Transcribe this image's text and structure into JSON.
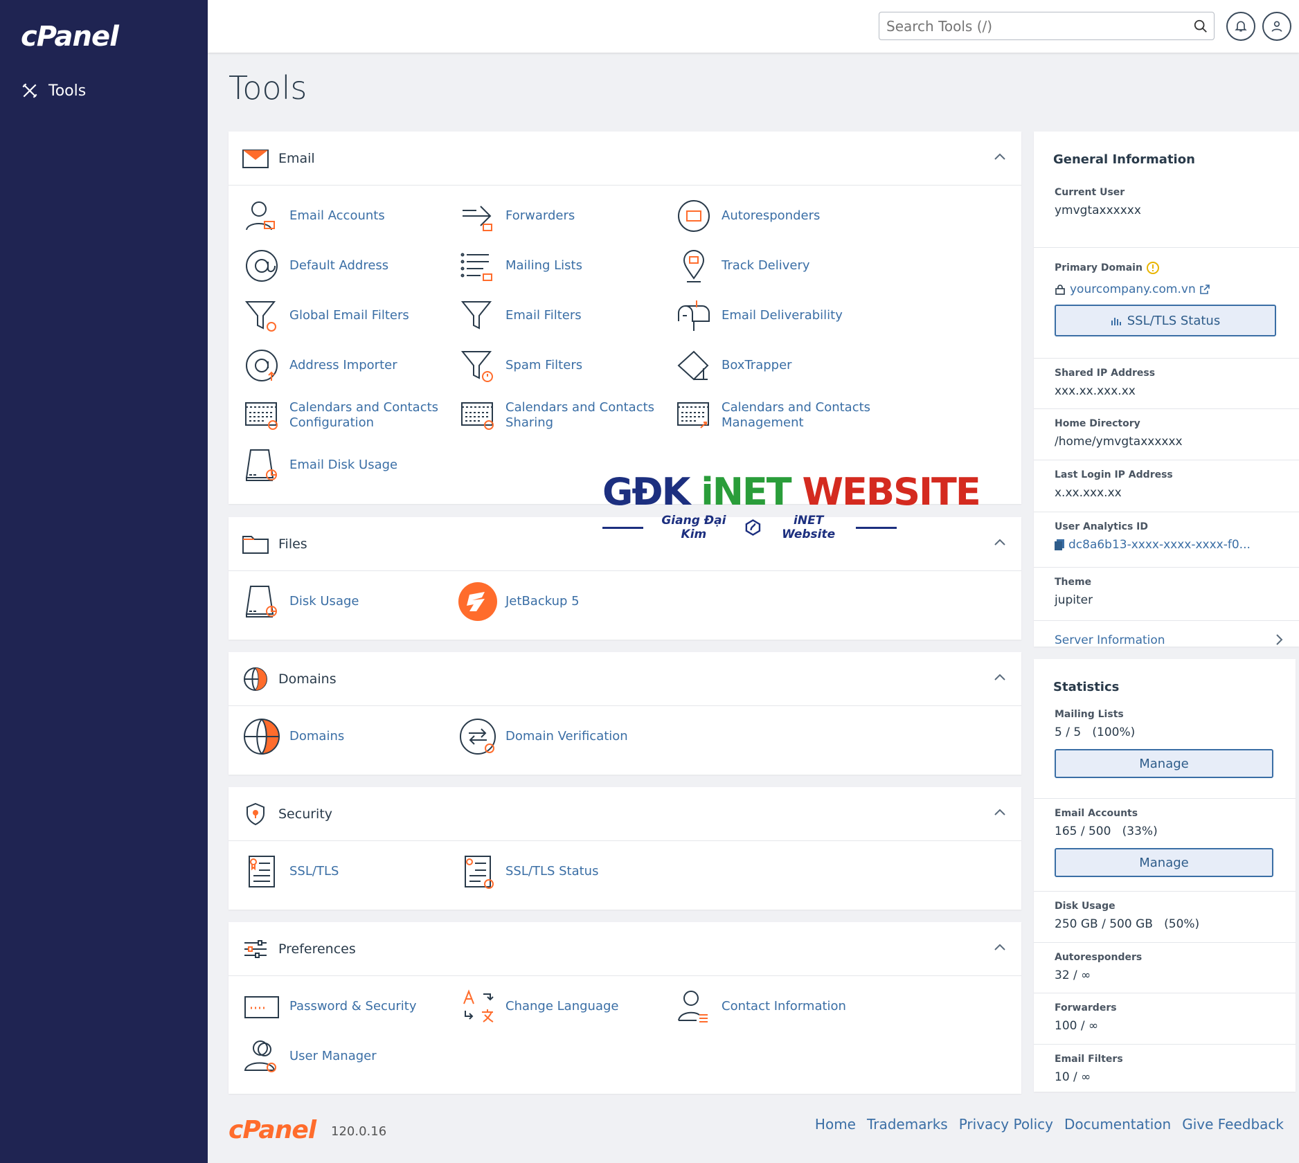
{
  "sidebar": {
    "brand": "cPanel",
    "nav_item": "Tools"
  },
  "topbar": {
    "search_placeholder": "Search Tools (/)"
  },
  "page_title": "Tools",
  "sections": {
    "email": {
      "title": "Email",
      "tools": [
        "Email Accounts",
        "Forwarders",
        "Autoresponders",
        "Default Address",
        "Mailing Lists",
        "Track Delivery",
        "Global Email Filters",
        "Email Filters",
        "Email Deliverability",
        "Address Importer",
        "Spam Filters",
        "BoxTrapper",
        "Calendars and Contacts Configuration",
        "Calendars and Contacts Sharing",
        "Calendars and Contacts Management",
        "Email Disk Usage"
      ]
    },
    "files": {
      "title": "Files",
      "tools": [
        "Disk Usage",
        "JetBackup 5"
      ]
    },
    "domains": {
      "title": "Domains",
      "tools": [
        "Domains",
        "Domain Verification"
      ]
    },
    "security": {
      "title": "Security",
      "tools": [
        "SSL/TLS",
        "SSL/TLS Status"
      ]
    },
    "preferences": {
      "title": "Preferences",
      "tools": [
        "Password & Security",
        "Change Language",
        "Contact Information",
        "User Manager"
      ]
    }
  },
  "general_info": {
    "title": "General Information",
    "current_user_label": "Current User",
    "current_user": "ymvgtaxxxxxx",
    "primary_domain_label": "Primary Domain",
    "primary_domain": "yourcompany.com.vn",
    "ssl_button": "SSL/TLS Status",
    "shared_ip_label": "Shared IP Address",
    "shared_ip": "xxx.xx.xxx.xx",
    "home_dir_label": "Home Directory",
    "home_dir": "/home/ymvgtaxxxxxx",
    "last_login_label": "Last Login IP Address",
    "last_login": "x.xx.xxx.xx",
    "analytics_label": "User Analytics ID",
    "analytics": "dc8a6b13-xxxx-xxxx-xxxx-f0...",
    "theme_label": "Theme",
    "theme": "jupiter",
    "server_info": "Server Information"
  },
  "statistics": {
    "title": "Statistics",
    "mailing_lists_label": "Mailing Lists",
    "mailing_lists": "5 / 5",
    "mailing_lists_pct": "(100%)",
    "manage1": "Manage",
    "email_accounts_label": "Email Accounts",
    "email_accounts": "165 / 500",
    "email_accounts_pct": "(33%)",
    "manage2": "Manage",
    "disk_usage_label": "Disk Usage",
    "disk_usage": "250 GB / 500 GB",
    "disk_usage_pct": "(50%)",
    "autoresponders_label": "Autoresponders",
    "autoresponders": "32 / ∞",
    "forwarders_label": "Forwarders",
    "forwarders": "100 / ∞",
    "email_filters_label": "Email Filters",
    "email_filters": "10 / ∞"
  },
  "footer": {
    "logo": "cPanel",
    "version": "120.0.16",
    "links": [
      "Home",
      "Trademarks",
      "Privacy Policy",
      "Documentation",
      "Give Feedback"
    ]
  },
  "watermark": {
    "part1": "GĐK ",
    "part2": "iNET",
    "part3": " WEBSITE",
    "subtitle_left": "Giang Đại Kim",
    "subtitle_right": "iNET Website"
  },
  "colors": {
    "sidebar": "#1f2452",
    "accent": "#ff6c2c",
    "link": "#3a6ea5"
  }
}
